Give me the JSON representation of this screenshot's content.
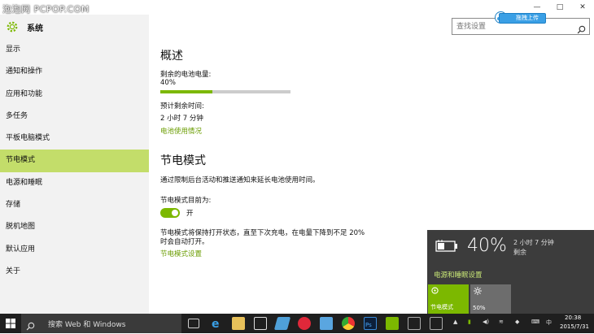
{
  "watermark": "泡泡网 PCPOP.COM",
  "window_controls": {
    "minimize": "—",
    "maximize": "□",
    "close": "✕"
  },
  "app": {
    "title": "系统"
  },
  "search": {
    "placeholder": "查找设置"
  },
  "upload_tag": "拖拽上传",
  "sidebar": {
    "items": [
      {
        "label": "显示"
      },
      {
        "label": "通知和操作"
      },
      {
        "label": "应用和功能"
      },
      {
        "label": "多任务"
      },
      {
        "label": "平板电脑模式"
      },
      {
        "label": "节电模式"
      },
      {
        "label": "电源和睡眠"
      },
      {
        "label": "存储"
      },
      {
        "label": "脱机地图"
      },
      {
        "label": "默认应用"
      },
      {
        "label": "关于"
      }
    ],
    "active_index": 5
  },
  "overview": {
    "heading": "概述",
    "remaining_label": "剩余的电池电量:",
    "remaining_value": "40%",
    "battery_level": 0.4,
    "estimate_label": "预计剩余时间:",
    "estimate_value": "2 小时 7 分钟",
    "usage_link": "电池使用情况"
  },
  "saver": {
    "heading": "节电模式",
    "description": "通过限制后台活动和推送通知来延长电池使用时间。",
    "state_label": "节电模式目前为:",
    "toggle_label": "开",
    "toggle_on": true,
    "note_line1": "节电模式将保持打开状态，直至下次充电，在电量下降到不足 20%",
    "note_line2": "时会自动打开。",
    "settings_link": "节电模式设置"
  },
  "flyout": {
    "percent": "40%",
    "time": "2 小时 7 分钟",
    "remaining": "剩余",
    "settings_link": "电源和睡眠设置",
    "tile_saver": "节电模式",
    "tile_brightness": "50%"
  },
  "taskbar": {
    "search_text": "搜索 Web 和 Windows",
    "ime": "中",
    "time": "20:38",
    "date": "2015/7/31"
  },
  "colors": {
    "accent": "#7cb800",
    "active_nav": "#c3dd6a",
    "taskbar": "#1f1f1f",
    "flyout": "#3c3c3c"
  }
}
